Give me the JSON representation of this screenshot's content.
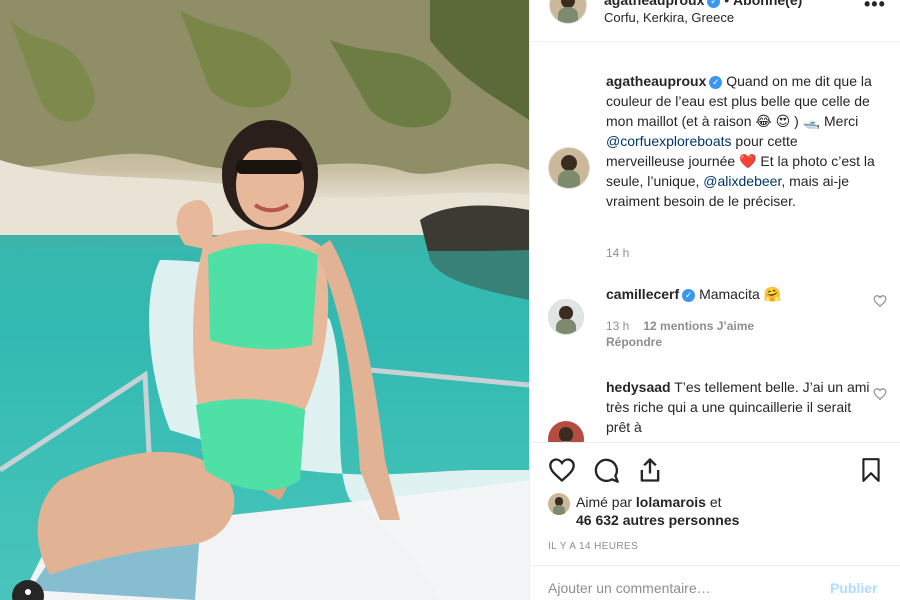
{
  "post": {
    "author": "agatheauproux",
    "follow_label": "Abonné(e)",
    "location": "Corfu, Kerkira, Greece"
  },
  "caption": {
    "username": "agatheauproux",
    "part1": "Quand on me dit que la couleur de l’eau est plus belle que celle de mon maillot (et à raison 😂 😍 ) 🛥️  Merci ",
    "mention1": "@corfuexploreboats",
    "part2": " pour cette merveilleuse journée ❤️  Et la photo c’est la seule, l’unique, ",
    "mention2": "@alixdebeer",
    "part3": ", mais ai-je vraiment besoin de le préciser.",
    "time": "14 h"
  },
  "comments": [
    {
      "username": "camillecerf",
      "text": "Mamacita 🤗",
      "time": "13 h",
      "likes": "12 mentions J’aime",
      "reply": "Répondre"
    },
    {
      "username": "hedysaad",
      "text": "T’es tellement belle. J’ai un ami très riche qui a une quincaillerie il serait prêt à"
    }
  ],
  "likes": {
    "liked_by_prefix": "Aimé par ",
    "liked_by_user": "lolamarois",
    "liked_by_suffix": " et",
    "count": "46 632 autres personnes"
  },
  "timestamp": "IL Y A 14 HEURES",
  "add_comment": {
    "placeholder": "Ajouter un commentaire…",
    "publish_label": "Publier"
  },
  "colors": {
    "verified": "#3897f0",
    "link": "#003569",
    "publish_disabled": "#b3dbff",
    "swimsuit": "#4ee0a5"
  }
}
